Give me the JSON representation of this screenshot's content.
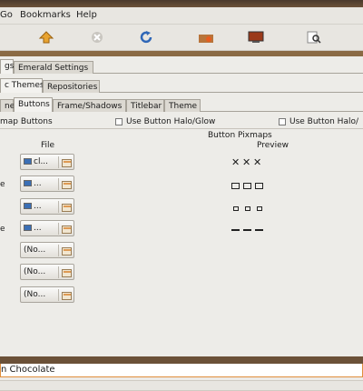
{
  "menubar": {
    "items": [
      {
        "label": "Go"
      },
      {
        "label": "Bookmarks"
      },
      {
        "label": "Help"
      }
    ]
  },
  "toolbar": {
    "icons": [
      "up-arrow-icon",
      "stop-icon",
      "reload-icon",
      "home-icon",
      "computer-icon",
      "search-icon"
    ]
  },
  "tabs_level1": [
    "gs",
    "Emerald Settings"
  ],
  "tabs_level2": [
    "c Themes",
    "Repositories"
  ],
  "tabs_level3": [
    "ne",
    "Buttons",
    "Frame/Shadows",
    "Titlebar",
    "Theme"
  ],
  "options": {
    "pixmap_buttons": "map Buttons",
    "halo_glow": "Use Button Halo/Glow",
    "halo_glow_2": "Use Button Halo/"
  },
  "table": {
    "section_title": "Button Pixmaps",
    "col_file": "File",
    "col_preview": "Preview",
    "rows": [
      {
        "label": "",
        "file": "cl...",
        "has_icon": true
      },
      {
        "label": "e",
        "file": "...",
        "has_icon": true
      },
      {
        "label": "",
        "file": "...",
        "has_icon": true
      },
      {
        "label": "e",
        "file": "...",
        "has_icon": true
      },
      {
        "label": "",
        "file": "(No...",
        "has_icon": false
      },
      {
        "label": "",
        "file": "(No...",
        "has_icon": false
      },
      {
        "label": "",
        "file": "(No...",
        "has_icon": false
      }
    ]
  },
  "status_input": {
    "value": "n Chocolate"
  }
}
